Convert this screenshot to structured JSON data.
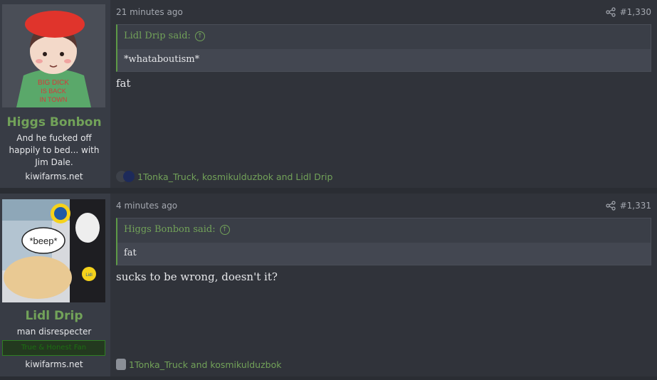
{
  "posts": [
    {
      "author": "Higgs Bonbon",
      "title": "And he fucked off happily to bed... with Jim Dale.",
      "site": "kiwifarms.net",
      "time": "21 minutes ago",
      "number": "#1,330",
      "quote": {
        "author": "Lidl Drip said:",
        "text": "*whataboutism*"
      },
      "body": "fat",
      "reactions": "1Tonka_Truck, kosmikulduzbok and Lidl Drip",
      "avatar_shirt_text": "BIG DICK IS BACK IN TOWN"
    },
    {
      "author": "Lidl Drip",
      "title": "man disrespecter",
      "banner": "True & Honest Fan",
      "site": "kiwifarms.net",
      "time": "4 minutes ago",
      "number": "#1,331",
      "quote": {
        "author": "Higgs Bonbon said:",
        "text": "fat"
      },
      "body": "sucks to be wrong, doesn't it?",
      "reactions": "1Tonka_Truck and kosmikulduzbok",
      "avatar_caption": "*beep*",
      "avatar_logo": "Lidl"
    }
  ],
  "colors": {
    "accent": "#72a259",
    "background": "#2a2d33",
    "post_bg": "#30333a",
    "sidebar_bg": "#383c45"
  },
  "icons": [
    "share-icon",
    "quote-up-arrow-icon",
    "reaction-icon"
  ]
}
